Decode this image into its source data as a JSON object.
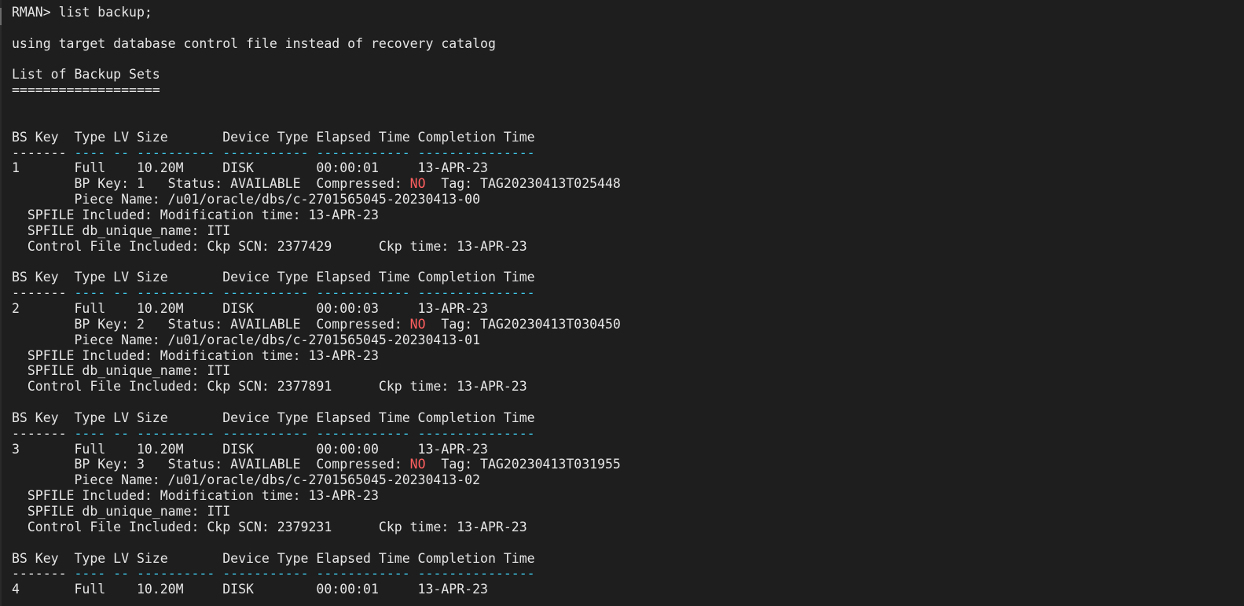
{
  "colors": {
    "background": "#1e1e1e",
    "text": "#e6e6e6",
    "highlight_red": "#ff5f5f",
    "separator_cyan": "#3fc7e8"
  },
  "lines": [
    {
      "segments": [
        {
          "text": "RMAN> list backup;",
          "color": "white"
        }
      ]
    },
    {
      "segments": []
    },
    {
      "segments": [
        {
          "text": "using target database control file instead of recovery catalog",
          "color": "white"
        }
      ]
    },
    {
      "segments": []
    },
    {
      "segments": [
        {
          "text": "List of Backup Sets",
          "color": "white"
        }
      ]
    },
    {
      "segments": [
        {
          "text": "===================",
          "color": "white"
        }
      ]
    },
    {
      "segments": []
    },
    {
      "segments": []
    },
    {
      "segments": [
        {
          "text": "BS Key  Type LV Size       Device Type Elapsed Time Completion Time",
          "color": "white"
        }
      ]
    },
    {
      "segments": [
        {
          "text": "------- ",
          "color": "white"
        },
        {
          "text": "---- -- ---------- ----------- ------------ ---------------",
          "color": "cyan"
        }
      ]
    },
    {
      "segments": [
        {
          "text": "1       Full    10.20M     DISK        00:00:01     13-APR-23",
          "color": "white"
        }
      ]
    },
    {
      "segments": [
        {
          "text": "        BP Key: 1   Status: AVAILABLE  Compressed: ",
          "color": "white"
        },
        {
          "text": "NO",
          "color": "red"
        },
        {
          "text": "  Tag: TAG20230413T025448",
          "color": "white"
        }
      ]
    },
    {
      "segments": [
        {
          "text": "        Piece Name: /u01/oracle/dbs/c-2701565045-20230413-00",
          "color": "white"
        }
      ]
    },
    {
      "segments": [
        {
          "text": "  SPFILE Included: Modification time: 13-APR-23",
          "color": "white"
        }
      ]
    },
    {
      "segments": [
        {
          "text": "  SPFILE db_unique_name: ITI",
          "color": "white"
        }
      ]
    },
    {
      "segments": [
        {
          "text": "  Control File Included: Ckp SCN: 2377429      Ckp time: 13-APR-23",
          "color": "white"
        }
      ]
    },
    {
      "segments": []
    },
    {
      "segments": [
        {
          "text": "BS Key  Type LV Size       Device Type Elapsed Time Completion Time",
          "color": "white"
        }
      ]
    },
    {
      "segments": [
        {
          "text": "------- ",
          "color": "white"
        },
        {
          "text": "---- -- ---------- ----------- ------------ ---------------",
          "color": "cyan"
        }
      ]
    },
    {
      "segments": [
        {
          "text": "2       Full    10.20M     DISK        00:00:03     13-APR-23",
          "color": "white"
        }
      ]
    },
    {
      "segments": [
        {
          "text": "        BP Key: 2   Status: AVAILABLE  Compressed: ",
          "color": "white"
        },
        {
          "text": "NO",
          "color": "red"
        },
        {
          "text": "  Tag: TAG20230413T030450",
          "color": "white"
        }
      ]
    },
    {
      "segments": [
        {
          "text": "        Piece Name: /u01/oracle/dbs/c-2701565045-20230413-01",
          "color": "white"
        }
      ]
    },
    {
      "segments": [
        {
          "text": "  SPFILE Included: Modification time: 13-APR-23",
          "color": "white"
        }
      ]
    },
    {
      "segments": [
        {
          "text": "  SPFILE db_unique_name: ITI",
          "color": "white"
        }
      ]
    },
    {
      "segments": [
        {
          "text": "  Control File Included: Ckp SCN: 2377891      Ckp time: 13-APR-23",
          "color": "white"
        }
      ]
    },
    {
      "segments": []
    },
    {
      "segments": [
        {
          "text": "BS Key  Type LV Size       Device Type Elapsed Time Completion Time",
          "color": "white"
        }
      ]
    },
    {
      "segments": [
        {
          "text": "------- ",
          "color": "white"
        },
        {
          "text": "---- -- ---------- ----------- ------------ ---------------",
          "color": "cyan"
        }
      ]
    },
    {
      "segments": [
        {
          "text": "3       Full    10.20M     DISK        00:00:00     13-APR-23",
          "color": "white"
        }
      ]
    },
    {
      "segments": [
        {
          "text": "        BP Key: 3   Status: AVAILABLE  Compressed: ",
          "color": "white"
        },
        {
          "text": "NO",
          "color": "red"
        },
        {
          "text": "  Tag: TAG20230413T031955",
          "color": "white"
        }
      ]
    },
    {
      "segments": [
        {
          "text": "        Piece Name: /u01/oracle/dbs/c-2701565045-20230413-02",
          "color": "white"
        }
      ]
    },
    {
      "segments": [
        {
          "text": "  SPFILE Included: Modification time: 13-APR-23",
          "color": "white"
        }
      ]
    },
    {
      "segments": [
        {
          "text": "  SPFILE db_unique_name: ITI",
          "color": "white"
        }
      ]
    },
    {
      "segments": [
        {
          "text": "  Control File Included: Ckp SCN: 2379231      Ckp time: 13-APR-23",
          "color": "white"
        }
      ]
    },
    {
      "segments": []
    },
    {
      "segments": [
        {
          "text": "BS Key  Type LV Size       Device Type Elapsed Time Completion Time",
          "color": "white"
        }
      ]
    },
    {
      "segments": [
        {
          "text": "------- ",
          "color": "white"
        },
        {
          "text": "---- -- ---------- ----------- ------------ ---------------",
          "color": "cyan"
        }
      ]
    },
    {
      "segments": [
        {
          "text": "4       Full    10.20M     DISK        00:00:01     13-APR-23",
          "color": "white"
        }
      ]
    }
  ]
}
